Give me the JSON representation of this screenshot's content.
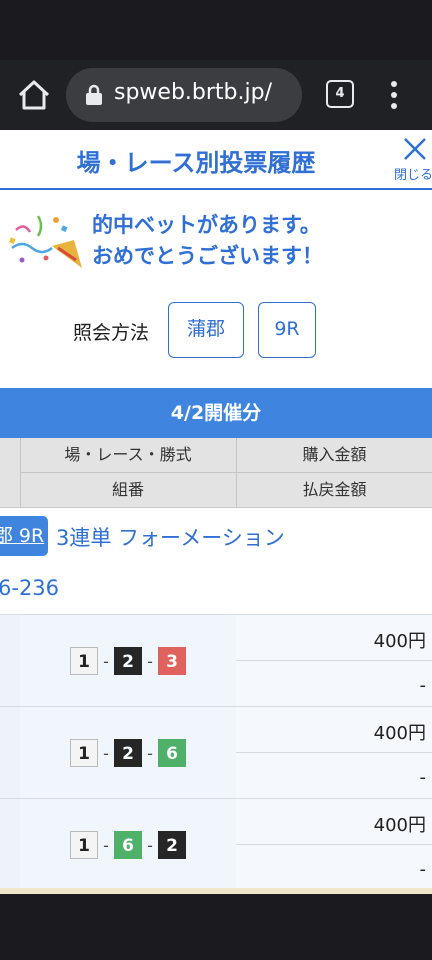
{
  "browser": {
    "url": "spweb.brtb.jp/",
    "tab_count": "4"
  },
  "header": {
    "title": "場・レース別投票履歴",
    "close_label": "閉じる"
  },
  "congrats": {
    "line1": "的中ベットがあります。",
    "line2": "おめでとうございます！"
  },
  "query": {
    "label": "照会方法",
    "venue": "蒲郡",
    "race": "9R"
  },
  "date_band": "4/2開催分",
  "table_header": {
    "col1": "場・レース・勝式",
    "col2": "購入金額",
    "col3": "組番",
    "col4": "払戻金額"
  },
  "race": {
    "badge": "郡 9R",
    "bet_type": "3連単 フォーメーション",
    "combo_summary": "6-236"
  },
  "rows": [
    {
      "boats": [
        "1",
        "2",
        "3"
      ],
      "amount": "400円",
      "payout": "-"
    },
    {
      "boats": [
        "1",
        "2",
        "6"
      ],
      "amount": "400円",
      "payout": "-"
    },
    {
      "boats": [
        "1",
        "6",
        "2"
      ],
      "amount": "400円",
      "payout": "-"
    }
  ],
  "boat_colors": {
    "1": {
      "bg": "#f4f4f4",
      "fg": "#222222",
      "border": "#bbbbbb"
    },
    "2": {
      "bg": "#262626",
      "fg": "#ffffff",
      "border": "#262626"
    },
    "3": {
      "bg": "#e0625f",
      "fg": "#ffffff",
      "border": "#e0625f"
    },
    "6": {
      "bg": "#4fb06a",
      "fg": "#ffffff",
      "border": "#4fb06a"
    }
  }
}
